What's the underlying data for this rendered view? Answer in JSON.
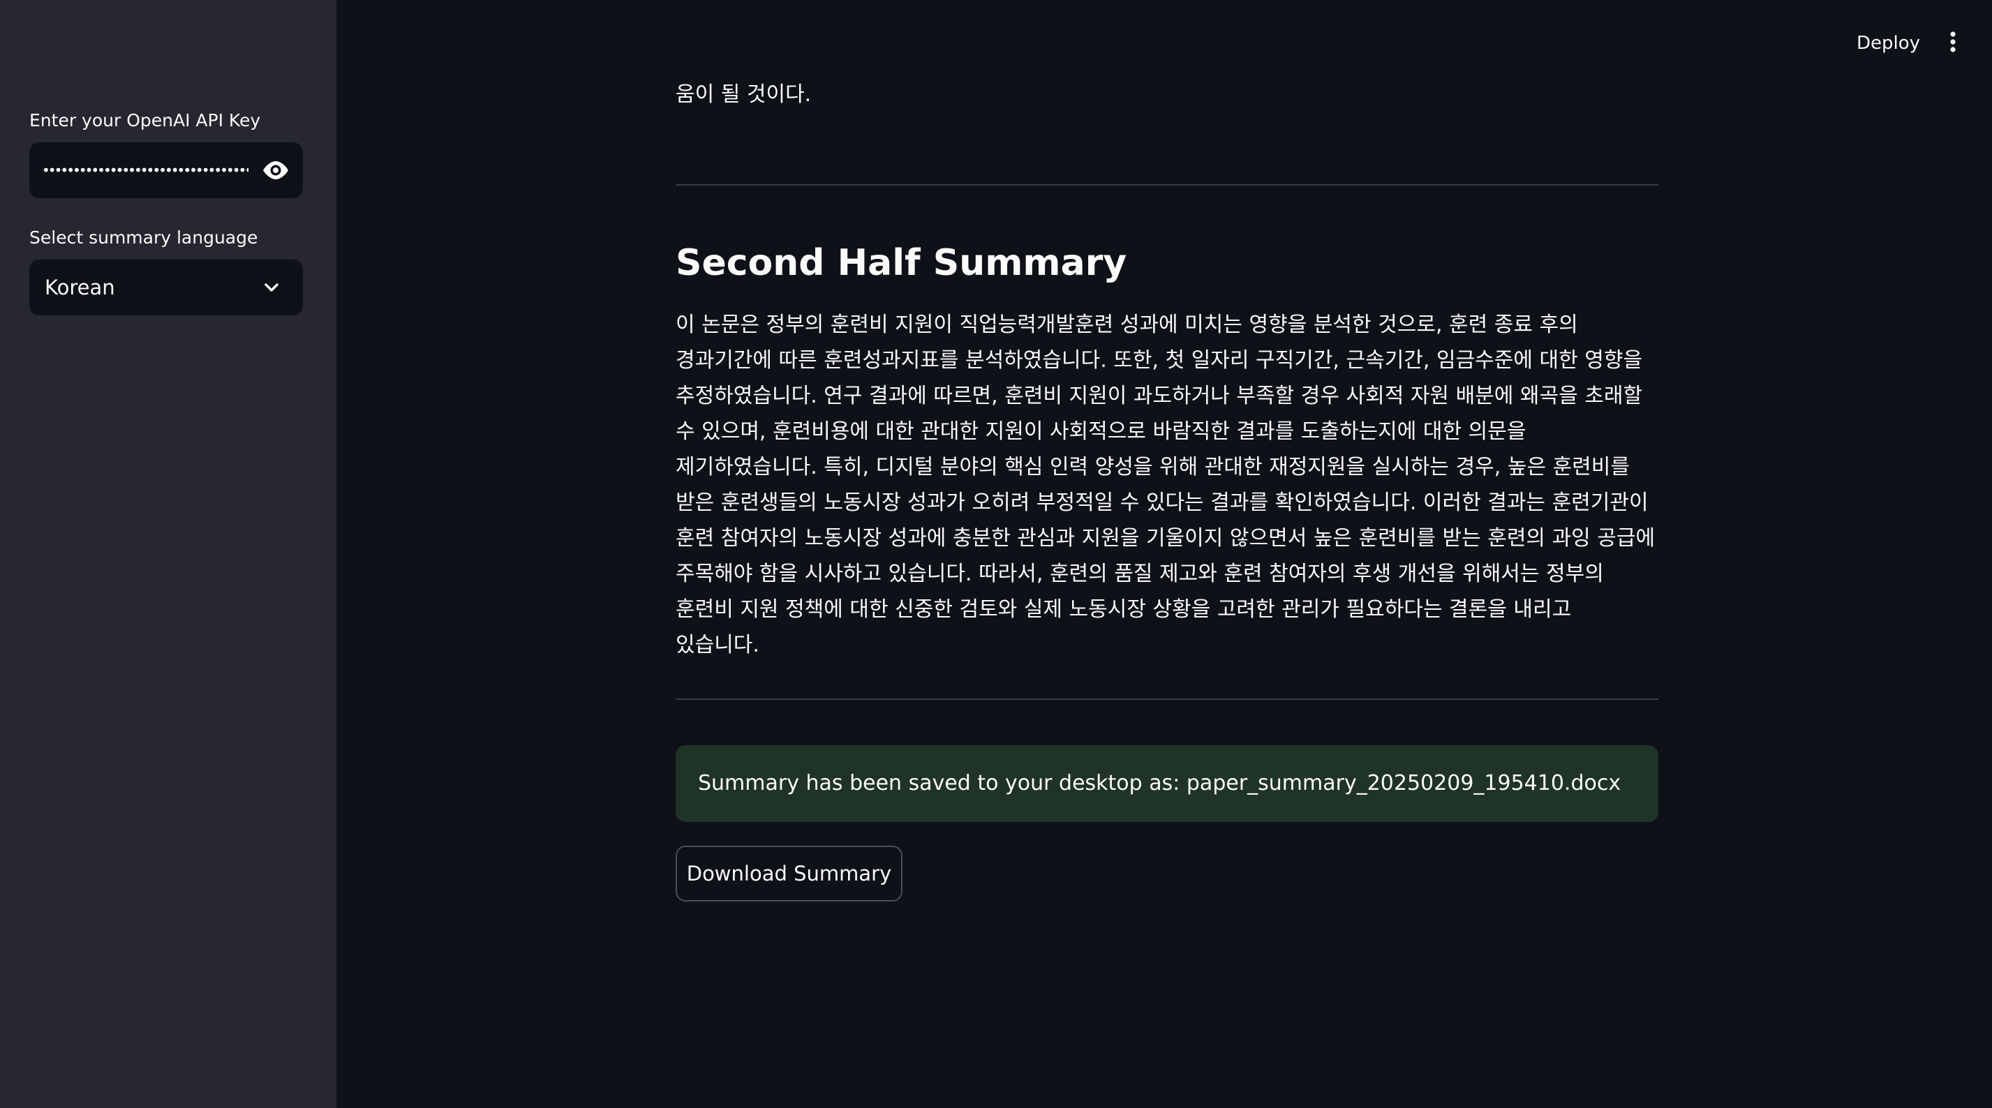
{
  "sidebar": {
    "api_key_label": "Enter your OpenAI API Key",
    "api_key_value": "••••••••••••••••••••••••••••••••••••",
    "api_key_toggle_icon": "eye-icon",
    "language_label": "Select summary language",
    "language_selected": "Korean",
    "language_chevron_icon": "chevron-down-icon"
  },
  "header": {
    "deploy_label": "Deploy",
    "menu_icon": "vertical-dots-icon"
  },
  "main": {
    "top_text": "움이 될 것이다.",
    "second_half": {
      "heading": "Second Half Summary",
      "body": "이 논문은 정부의 훈련비 지원이 직업능력개발훈련 성과에 미치는 영향을 분석한 것으로, 훈련 종료 후의 경과기간에 따른 훈련성과지표를 분석하였습니다. 또한, 첫 일자리 구직기간, 근속기간, 임금수준에 대한 영향을 추정하였습니다. 연구 결과에 따르면, 훈련비 지원이 과도하거나 부족할 경우 사회적 자원 배분에 왜곡을 초래할 수 있으며, 훈련비용에 대한 관대한 지원이 사회적으로 바람직한 결과를 도출하는지에 대한 의문을 제기하였습니다. 특히, 디지털 분야의 핵심 인력 양성을 위해 관대한 재정지원을 실시하는 경우, 높은 훈련비를 받은 훈련생들의 노동시장 성과가 오히려 부정적일 수 있다는 결과를 확인하였습니다. 이러한 결과는 훈련기관이 훈련 참여자의 노동시장 성과에 충분한 관심과 지원을 기울이지 않으면서 높은 훈련비를 받는 훈련의 과잉 공급에 주목해야 함을 시사하고 있습니다. 따라서, 훈련의 품질 제고와 훈련 참여자의 후생 개선을 위해서는 정부의 훈련비 지원 정책에 대한 신중한 검토와 실제 노동시장 상황을 고려한 관리가 필요하다는 결론을 내리고 있습니다."
    },
    "success_message": "Summary has been saved to your desktop as: paper_summary_20250209_195410.docx",
    "download_label": "Download Summary"
  },
  "colors": {
    "app_background": "#0e1117",
    "sidebar_background": "#262730",
    "success_background": "#1f3326",
    "divider": "#3a3d47"
  }
}
